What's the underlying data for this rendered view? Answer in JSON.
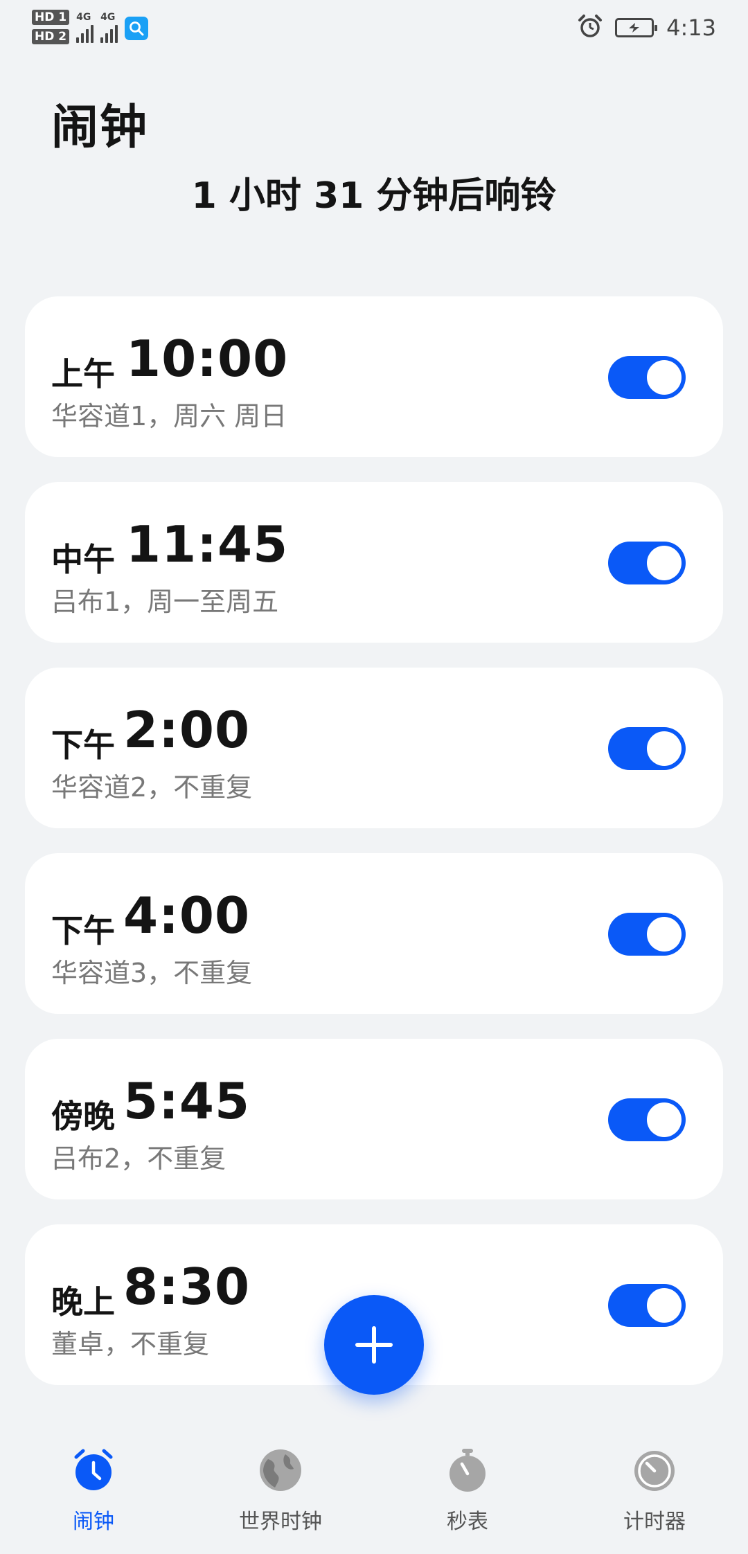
{
  "status_bar": {
    "sim1": "HD 1",
    "sim2": "HD 2",
    "network1": "4G",
    "network2": "4G",
    "time": "4:13"
  },
  "header": {
    "title": "闹钟",
    "next_ring": "1 小时 31 分钟后响铃"
  },
  "alarms": [
    {
      "period": "上午",
      "time": "10:00",
      "desc": "华容道1，周六 周日",
      "enabled": true
    },
    {
      "period": "中午",
      "time": "11:45",
      "desc": "吕布1，周一至周五",
      "enabled": true
    },
    {
      "period": "下午",
      "time": "2:00",
      "desc": "华容道2，不重复",
      "enabled": true
    },
    {
      "period": "下午",
      "time": "4:00",
      "desc": "华容道3，不重复",
      "enabled": true
    },
    {
      "period": "傍晚",
      "time": "5:45",
      "desc": "吕布2，不重复",
      "enabled": true
    },
    {
      "period": "晚上",
      "time": "8:30",
      "desc": "董卓，不重复",
      "enabled": true
    }
  ],
  "nav": {
    "tabs": [
      {
        "label": "闹钟",
        "icon": "alarm-clock-icon",
        "active": true
      },
      {
        "label": "世界时钟",
        "icon": "globe-icon",
        "active": false
      },
      {
        "label": "秒表",
        "icon": "stopwatch-icon",
        "active": false
      },
      {
        "label": "计时器",
        "icon": "timer-icon",
        "active": false
      }
    ]
  },
  "colors": {
    "accent": "#0a59f7",
    "background": "#f1f3f5",
    "card": "#ffffff",
    "secondary_text": "#787878"
  }
}
